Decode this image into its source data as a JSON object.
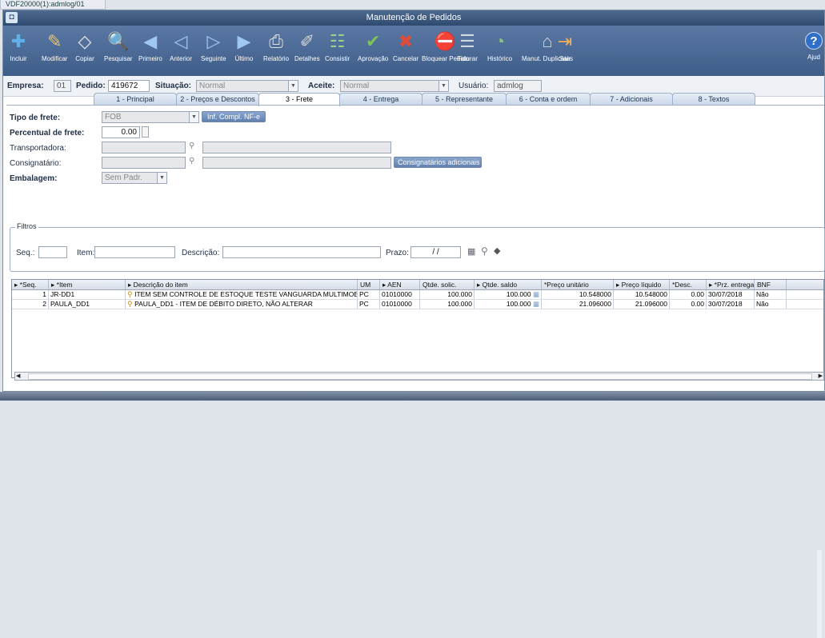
{
  "doc_tab": "VDF20000(1):admlog/01",
  "title": "Manutenção de Pedidos",
  "toolbar": [
    {
      "label": "Incluir",
      "icon": "add-icon",
      "glyph": "✚",
      "color": "#5fb0e8"
    },
    {
      "label": "Modificar",
      "icon": "edit-icon",
      "glyph": "✎",
      "color": "#e9c36b"
    },
    {
      "label": "Copiar",
      "icon": "copy-icon",
      "glyph": "◇",
      "color": "#e8e8e8"
    },
    {
      "label": "Pesquisar",
      "icon": "search-icon",
      "glyph": "🔍",
      "color": "#bfe0ff"
    },
    {
      "label": "Primeiro",
      "icon": "first-icon",
      "glyph": "◀",
      "color": "#9fc8f0"
    },
    {
      "label": "Anterior",
      "icon": "previous-icon",
      "glyph": "◁",
      "color": "#9fc8f0"
    },
    {
      "label": "Seguinte",
      "icon": "next-icon",
      "glyph": "▷",
      "color": "#9fc8f0"
    },
    {
      "label": "Último",
      "icon": "last-icon",
      "glyph": "▶",
      "color": "#9fc8f0"
    },
    {
      "label": "Relatório",
      "icon": "printer-icon",
      "glyph": "⎙",
      "color": "#e0e0e0"
    },
    {
      "label": "Detalhes",
      "icon": "details-icon",
      "glyph": "✐",
      "color": "#d8d8d8"
    },
    {
      "label": "Consistir",
      "icon": "check-data-icon",
      "glyph": "☷",
      "color": "#9ad08a"
    },
    {
      "label": "Aprovação",
      "icon": "approval-icon",
      "glyph": "✔",
      "color": "#7cc25a"
    },
    {
      "label": "Cancelar",
      "icon": "cancel-icon",
      "glyph": "✖",
      "color": "#e24b3a"
    },
    {
      "label": "Bloquear Pedido",
      "icon": "block-order-icon",
      "glyph": "⛔",
      "color": "#e24b3a"
    },
    {
      "label": "Faturar",
      "icon": "invoice-icon",
      "glyph": "☰",
      "color": "#d0d8e0"
    },
    {
      "label": "Histórico",
      "icon": "history-icon",
      "glyph": "◔",
      "color": "#8ec97a"
    },
    {
      "label": "Manut. Duplicatas",
      "icon": "duplicates-icon",
      "glyph": "⌂",
      "color": "#d0d8e0"
    },
    {
      "label": "Sair",
      "icon": "exit-icon",
      "glyph": "⇥",
      "color": "#f0b060"
    }
  ],
  "help_label": "Ajud",
  "header": {
    "empresa_label": "Empresa:",
    "empresa_value": "01",
    "pedido_label": "Pedido:",
    "pedido_value": "419672",
    "situacao_label": "Situação:",
    "situacao_value": "Normal",
    "aceite_label": "Aceite:",
    "aceite_value": "Normal",
    "usuario_label": "Usuário:",
    "usuario_value": "admlog"
  },
  "tabs": [
    {
      "label": "1 - Principal",
      "active": false
    },
    {
      "label": "2 - Preços e Descontos",
      "active": false
    },
    {
      "label": "3 - Frete",
      "active": true
    },
    {
      "label": "4 - Entrega",
      "active": false
    },
    {
      "label": "5 - Representante",
      "active": false
    },
    {
      "label": "6 - Conta e ordem",
      "active": false
    },
    {
      "label": "7 - Adicionais",
      "active": false
    },
    {
      "label": "8 - Textos",
      "active": false
    }
  ],
  "frete": {
    "tipo_label": "Tipo de frete:",
    "tipo_value": "FOB",
    "inf_compl_button": "Inf. Compl. NF-e",
    "percentual_label": "Percentual de frete:",
    "percentual_value": "0.00",
    "transportadora_label": "Transportadora:",
    "consignatario_label": "Consignatário:",
    "consignatarios_button": "Consignatários adicionais",
    "embalagem_label": "Embalagem:",
    "embalagem_value": "Sem Padr."
  },
  "filtros": {
    "legend": "Filtros",
    "seq_label": "Seq.:",
    "item_label": "Item:",
    "descricao_label": "Descrição:",
    "prazo_label": "Prazo:",
    "prazo_value": "/ /"
  },
  "grid": {
    "columns": [
      "*Seq.",
      "*Item",
      "Descrição do item",
      "UM",
      "AEN",
      "Qtde. solic.",
      "Qtde. saldo",
      "*Preço unitário",
      "Preço líquido",
      "*Desc.",
      "*Prz. entrega",
      "BNF"
    ],
    "rows": [
      [
        "1",
        "JR-DD1",
        "ITEM SEM CONTROLE DE ESTOQUE TESTE VANGUARDA MULTIMOEDAS",
        "PC",
        "01010000",
        "100.000",
        "100.000",
        "10.548000",
        "10.548000",
        "0.00",
        "30/07/2018",
        "Não"
      ],
      [
        "2",
        "PAULA_DD1",
        "PAULA_DD1 - ITEM DE DÉBITO DIRETO, NÃO ALTERAR",
        "PC",
        "01010000",
        "100.000",
        "100.000",
        "21.096000",
        "21.096000",
        "0.00",
        "30/07/2018",
        "Não"
      ]
    ]
  }
}
